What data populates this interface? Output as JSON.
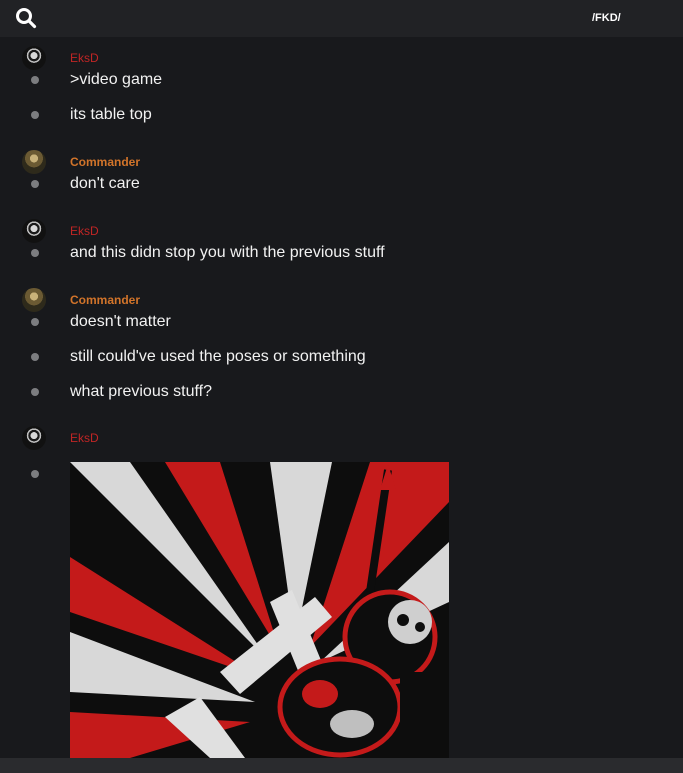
{
  "header": {
    "channel_name": "/FKD/"
  },
  "icons": {
    "search": "search-icon"
  },
  "colors": {
    "eksd_name": "#c02525",
    "commander_name": "#d2742a",
    "background": "#18191c",
    "topbar": "#212225"
  },
  "messages": [
    {
      "author": "EksD",
      "lines": [
        ">video game",
        "its table top"
      ]
    },
    {
      "author": "Commander",
      "lines": [
        "don't care"
      ]
    },
    {
      "author": "EksD",
      "lines": [
        "and this didn stop you with the previous stuff"
      ]
    },
    {
      "author": "Commander",
      "lines": [
        "doesn't matter",
        "still could've used the poses or something",
        "what previous stuff?"
      ]
    },
    {
      "author": "EksD",
      "attachment": "image"
    }
  ]
}
